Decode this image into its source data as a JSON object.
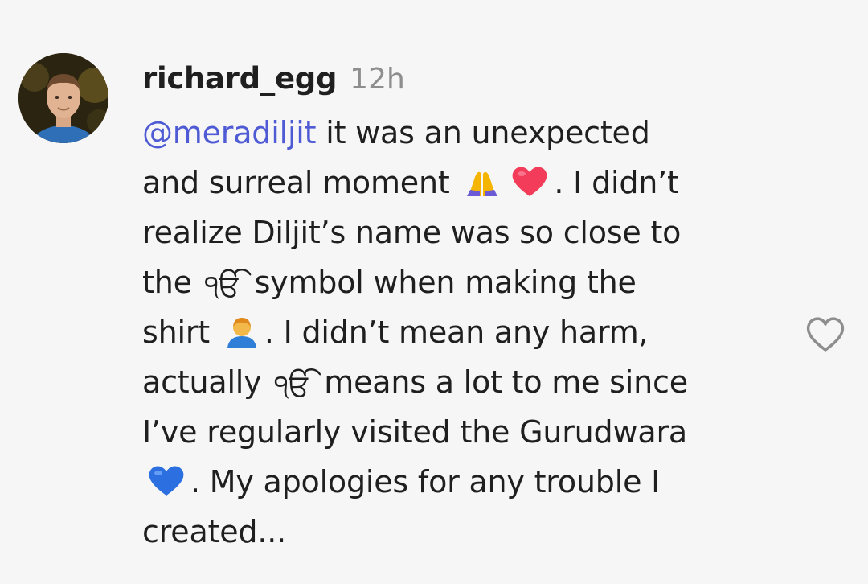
{
  "comment": {
    "username": "richard_egg",
    "timestamp": "12h",
    "mention": "@meradiljit",
    "lines": [
      " it was an unexpected",
      "and surreal moment ",
      ". I didn’t",
      "realize Diljit’s name was so close to",
      "the ",
      " symbol when making the",
      "shirt ",
      ". I didn’t mean any harm,",
      "actually ",
      " means a lot to me since",
      "I’ve regularly visited the Gurudwara",
      ". My apologies for any trouble I",
      "created..."
    ],
    "symbol_text": "ੴ",
    "icons": {
      "emoji_pray": "folded-hands-icon",
      "emoji_heart": "red-heart-icon",
      "emoji_person": "person-icon",
      "emoji_blue_heart": "blue-heart-icon",
      "like": "heart-outline-icon"
    },
    "colors": {
      "mention": "#4f5bd5",
      "text": "#1f1f1f",
      "timestamp": "#8e8e8e",
      "like_icon": "#8e8e8e"
    }
  }
}
